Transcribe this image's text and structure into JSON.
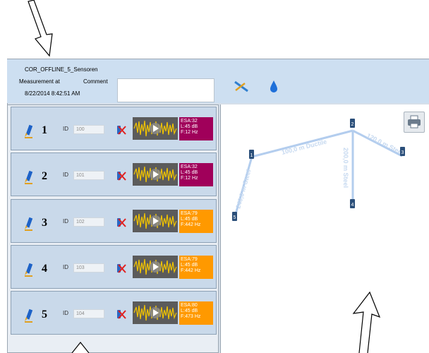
{
  "header": {
    "file_name": "COR_OFFLINE_5_Sensoren",
    "measurement_label": "Measurement at",
    "comment_label": "Comment",
    "measurement_datetime": "8/22/2014 8:42:51 AM",
    "comment_value": "",
    "tool_icons": [
      "tool-icon",
      "water-drop-icon"
    ]
  },
  "sensors": [
    {
      "number": "1",
      "id_label": "ID",
      "id_value": "100",
      "esa": "ESA:32",
      "level": "L:45 dB",
      "freq": "F:12 Hz",
      "color": "#a0005a"
    },
    {
      "number": "2",
      "id_label": "ID",
      "id_value": "101",
      "esa": "ESA:32",
      "level": "L:45 dB",
      "freq": "F:12 Hz",
      "color": "#a0005a"
    },
    {
      "number": "3",
      "id_label": "ID",
      "id_value": "102",
      "esa": "ESA:79",
      "level": "L:45 dB",
      "freq": "F:442 Hz",
      "color": "#ff9900"
    },
    {
      "number": "4",
      "id_label": "ID",
      "id_value": "103",
      "esa": "ESA:79",
      "level": "L:45 dB",
      "freq": "F:442 Hz",
      "color": "#ff9900"
    },
    {
      "number": "5",
      "id_label": "ID",
      "id_value": "104",
      "esa": "ESA:80",
      "level": "L:45 dB",
      "freq": "F:473 Hz",
      "color": "#ff9900"
    }
  ],
  "map": {
    "nodes": [
      "1",
      "2",
      "3",
      "4",
      "5"
    ],
    "pipes": [
      {
        "label": "100,0 m Ductile"
      },
      {
        "label": "120,0 m Steel"
      },
      {
        "label": "200,0 m Steel"
      },
      {
        "label": "240,0 m Steel"
      }
    ]
  },
  "colors": {
    "header_bg": "#cddff1",
    "row_bg": "#c9d9ea",
    "pipe": "#b3cdee",
    "esa_magenta": "#a0005a",
    "esa_orange": "#ff9900"
  }
}
